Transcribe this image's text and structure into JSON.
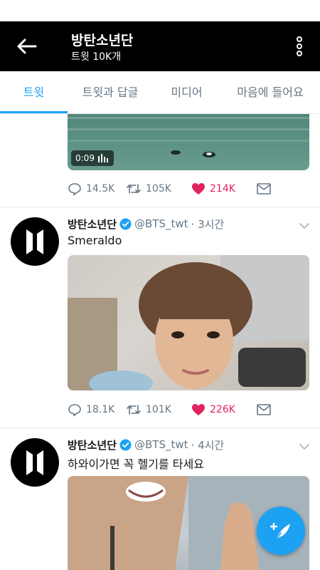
{
  "header": {
    "title": "방탄소년단",
    "subtitle": "트윗 10K개"
  },
  "tabs": [
    {
      "label": "트윗",
      "active": true
    },
    {
      "label": "트윗과 답글",
      "active": false
    },
    {
      "label": "미디어",
      "active": false
    },
    {
      "label": "마음에 들어요",
      "active": false
    }
  ],
  "tweets": [
    {
      "media": {
        "type": "video",
        "duration": "0:09"
      },
      "stats": {
        "replies": "14.5K",
        "retweets": "105K",
        "likes": "214K"
      },
      "liked": true
    },
    {
      "name": "방탄소년단",
      "handle": "@BTS_twt",
      "time": "· 3시간",
      "text": "Smeraldo",
      "verified": true,
      "media": {
        "type": "photo"
      },
      "stats": {
        "replies": "18.1K",
        "retweets": "101K",
        "likes": "226K"
      },
      "liked": true
    },
    {
      "name": "방탄소년단",
      "handle": "@BTS_twt",
      "time": "· 4시간",
      "text": "하와이가면 꼭 헬기를 타세요",
      "verified": true,
      "media": {
        "type": "photo"
      }
    }
  ],
  "colors": {
    "accent": "#1da1f2",
    "like": "#e0245e",
    "header_bg": "#000000",
    "muted": "#657786"
  },
  "icons": {
    "back": "arrow-left-icon",
    "more": "more-vertical-icon",
    "reply": "reply-icon",
    "retweet": "retweet-icon",
    "like": "heart-icon",
    "dm": "envelope-icon",
    "verified": "verified-badge-icon",
    "compose": "compose-tweet-icon"
  }
}
